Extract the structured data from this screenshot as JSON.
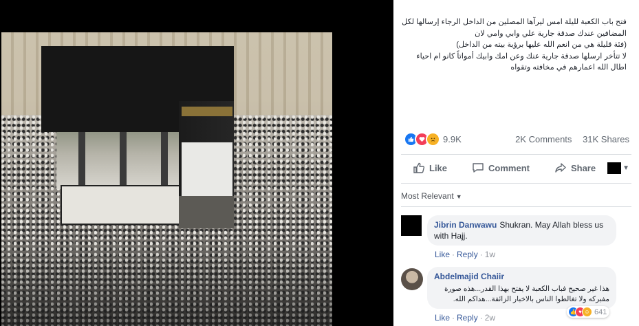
{
  "post": {
    "text": "فتح باب الكعبة لليلة امس ليرآها المصلين من الداخل الرجاء إرسالها لكل\nالمضافين عندك صدقة جارية علي وابي وامي لان\n(فئة قليلة هي من انعم الله عليها برؤية بيته من الداخل)\nلا تتأخر ارسلها صدقة جارية عنك وعن امك وابيك أمواتاً كانو ام احياء\nاطال الله اعمارهم في مخافته وتقواه",
    "reaction_count": "9.9K",
    "comments_count": "2K Comments",
    "shares_count": "31K Shares"
  },
  "actions": {
    "like": "Like",
    "comment": "Comment",
    "share": "Share"
  },
  "filter": {
    "label": "Most Relevant"
  },
  "comments": [
    {
      "author": "Jibrin Danwawu",
      "text": "Shukran. May Allah bless us with Hajj.",
      "like": "Like",
      "reply": "Reply",
      "time": "1w"
    },
    {
      "author": "Abdelmajid Chaiir",
      "text": "هذا غير صحيح فباب الكعبة لا يفتح بهذا القدر...هذه صورة\nمفبركه ولا تغالطوا الناس بالاخبار الزائفة...هداكم الله.",
      "like": "Like",
      "reply": "Reply",
      "time": "2w",
      "reaction_count": "641"
    }
  ],
  "icons": {
    "reactions": [
      "like-reaction-icon",
      "love-reaction-icon",
      "sad-reaction-icon"
    ],
    "comment_reactions": [
      "like-reaction-icon",
      "love-reaction-icon",
      "haha-reaction-icon"
    ]
  },
  "colors": {
    "link": "#365899",
    "like_blue": "#1877f2",
    "love_red": "#f33e58",
    "sad_yellow": "#f7b125",
    "meta_gray": "#606770"
  }
}
